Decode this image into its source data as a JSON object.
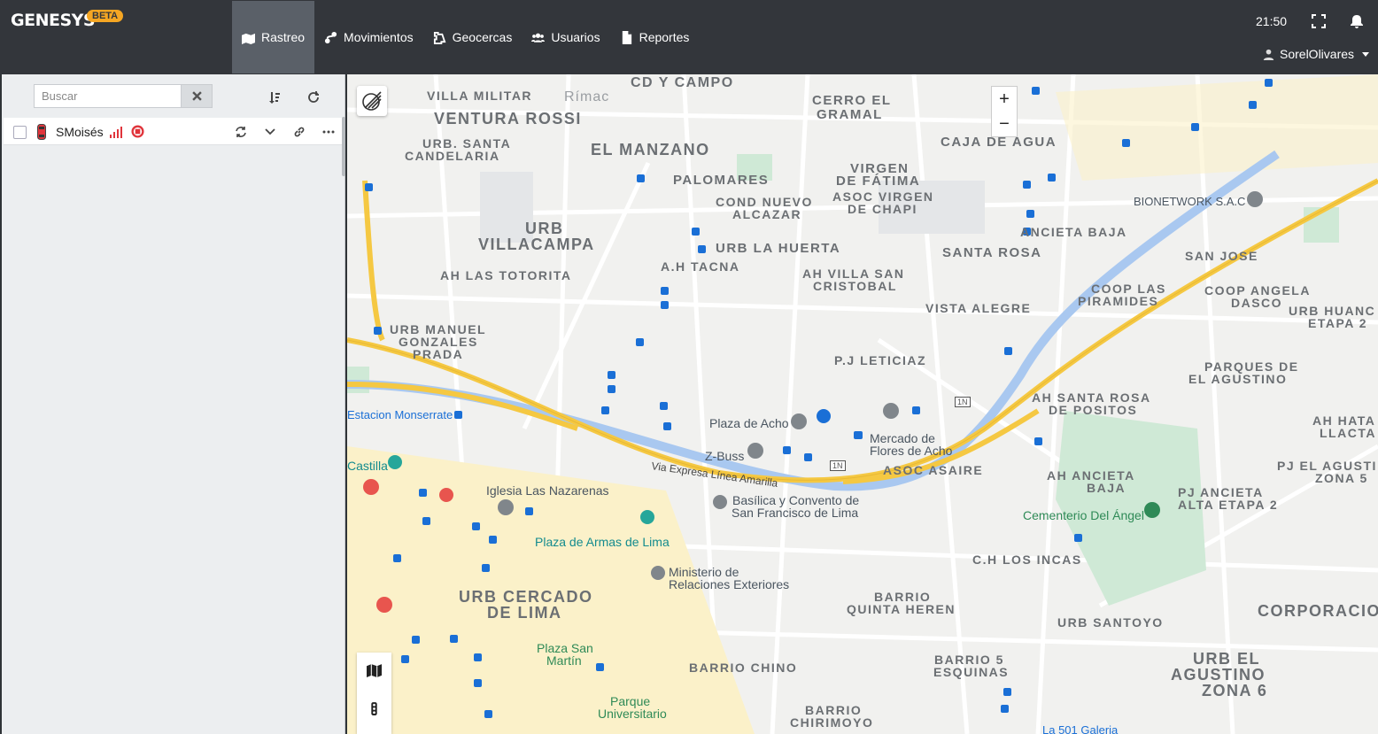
{
  "brand": {
    "name": "GENESYS",
    "badge": "BETA"
  },
  "nav": [
    {
      "label": "Rastreo",
      "icon": "map-marked-icon",
      "active": true
    },
    {
      "label": "Movimientos",
      "icon": "route-icon",
      "active": false
    },
    {
      "label": "Geocercas",
      "icon": "draw-polygon-icon",
      "active": false
    },
    {
      "label": "Usuarios",
      "icon": "users-icon",
      "active": false
    },
    {
      "label": "Reportes",
      "icon": "file-icon",
      "active": false
    }
  ],
  "header": {
    "time": "21:50",
    "user": "SorelOlivares"
  },
  "sidebar": {
    "search_placeholder": "Buscar",
    "units": [
      {
        "name": "SMoisés",
        "status_color": "#e0343b"
      }
    ]
  },
  "map": {
    "neighborhoods": [
      "VILLA MILITAR",
      "VENTURA ROSSI",
      "CD Y CAMPO",
      "CERRO EL",
      "GRAMAL",
      "CAJA DE AGUA",
      "URB. SANTA",
      "CANDELARIA",
      "EL MANZANO",
      "PALOMARES",
      "VIRGEN",
      "DE FÁTIMA",
      "COND NUEVO",
      "ALCAZAR",
      "ASOC VIRGEN",
      "DE CHAPI",
      "URB",
      "VILLACAMPA",
      "URB LA HUERTA",
      "A.H TACNA",
      "SANTA ROSA",
      "ANCIETA BAJA",
      "AH LAS TOTORITA",
      "AH VILLA SAN",
      "CRISTOBAL",
      "SAN JOSE",
      "COOP LAS",
      "PIRAMIDES",
      "COOP ANGELA",
      "DASCO",
      "URB MANUEL",
      "GONZALES",
      "PRADA",
      "VISTA ALEGRE",
      "P.J LETICIAZ",
      "PARQUES DE",
      "EL AGUSTINO",
      "AH SANTA ROSA",
      "DE POSITOS",
      "ASOC ASAIRE",
      "AH ANCIETA",
      "BAJA",
      "PJ ANCIETA",
      "ALTA ETAPA 2",
      "C.H LOS INCAS",
      "URB CERCADO",
      "DE LIMA",
      "BARRIO",
      "QUINTA HEREN",
      "URB SANTOYO",
      "BARRIO 5",
      "ESQUINAS",
      "BARRIO CHINO",
      "BARRIO",
      "CHIRIMOYO",
      "URB EL",
      "AGUSTINO",
      "ZONA 6",
      "CORPORACIO",
      "PJ EL AGUSTI",
      "ZONA 5",
      "URB HUANC",
      "ETAPA 2",
      "AH HATA",
      "LLACTA"
    ],
    "pois": [
      "Plaza de Acho",
      "Z-Buss",
      "Mercado de",
      "Flores de Acho",
      "Iglesia Las Nazarenas",
      "Basílica y Convento de",
      "San Francisco de Lima",
      "Plaza de Armas de Lima",
      "Ministerio de",
      "Relaciones Exteriores",
      "Plaza San",
      "Martín",
      "Parque",
      "Universitario",
      "Estacion Monserrate",
      "Castilla",
      "BIONETWORK S.A.C",
      "Cementerio Del Ángel",
      "La 501 Galeria",
      "Rímac"
    ],
    "roads": [
      "Via Expresa Línea Amarilla",
      "1N"
    ],
    "zoom_in": "+",
    "zoom_out": "−"
  }
}
